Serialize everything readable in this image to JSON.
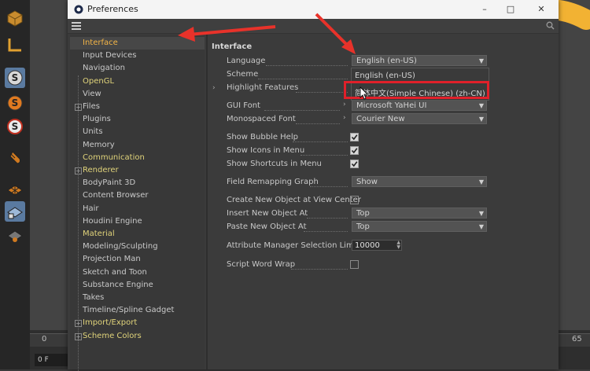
{
  "window": {
    "title": "Preferences",
    "minimize": "–",
    "maximize": "□",
    "close": "✕"
  },
  "timeline": {
    "start_label": "0",
    "end_label": "65",
    "current_frame": "0 F"
  },
  "sidebar": {
    "items": [
      {
        "label": "Interface",
        "state": "selected"
      },
      {
        "label": "Input Devices"
      },
      {
        "label": "Navigation"
      },
      {
        "label": "OpenGL"
      },
      {
        "label": "View"
      },
      {
        "label": "Files",
        "expander": "+"
      },
      {
        "label": "Plugins"
      },
      {
        "label": "Units"
      },
      {
        "label": "Memory"
      },
      {
        "label": "Communication"
      },
      {
        "label": "Renderer",
        "expander": "+"
      },
      {
        "label": "BodyPaint 3D"
      },
      {
        "label": "Content Browser"
      },
      {
        "label": "Hair"
      },
      {
        "label": "Houdini Engine"
      },
      {
        "label": "Material"
      },
      {
        "label": "Modeling/Sculpting"
      },
      {
        "label": "Projection Man"
      },
      {
        "label": "Sketch and Toon"
      },
      {
        "label": "Substance Engine"
      },
      {
        "label": "Takes"
      },
      {
        "label": "Timeline/Spline Gadget"
      },
      {
        "label": "Import/Export",
        "expander": "+"
      },
      {
        "label": "Scheme Colors",
        "expander": "+"
      }
    ]
  },
  "content": {
    "section_title": "Interface",
    "language": {
      "label": "Language",
      "value": "English (en-US)"
    },
    "language_options": [
      "English (en-US)",
      "简体中文(Simple Chinese) (zh-CN)"
    ],
    "scheme": {
      "label": "Scheme"
    },
    "highlight": {
      "label": "Highlight Features"
    },
    "gui_font": {
      "label": "GUI Font",
      "value": "Microsoft YaHei UI"
    },
    "mono_font": {
      "label": "Monospaced Font",
      "value": "Courier New"
    },
    "bubble_help": {
      "label": "Show Bubble Help",
      "checked": true
    },
    "icons_menu": {
      "label": "Show Icons in Menu",
      "checked": true
    },
    "shortcuts_menu": {
      "label": "Show Shortcuts in Menu",
      "checked": true
    },
    "field_remap": {
      "label": "Field Remapping Graph",
      "value": "Show"
    },
    "create_center": {
      "label": "Create New Object at View Center",
      "checked": false
    },
    "insert_new": {
      "label": "Insert New Object At",
      "value": "Top"
    },
    "paste_new": {
      "label": "Paste New Object At",
      "value": "Top"
    },
    "attr_limit": {
      "label": "Attribute Manager Selection Limit",
      "value": "10000"
    },
    "word_wrap": {
      "label": "Script Word Wrap",
      "checked": false
    }
  },
  "colors": {
    "selected_item": "#f2b447",
    "highlight_box": "#e0202a",
    "annotation_arrow": "#e8322a",
    "decoration_yellow": "#f2b233"
  }
}
